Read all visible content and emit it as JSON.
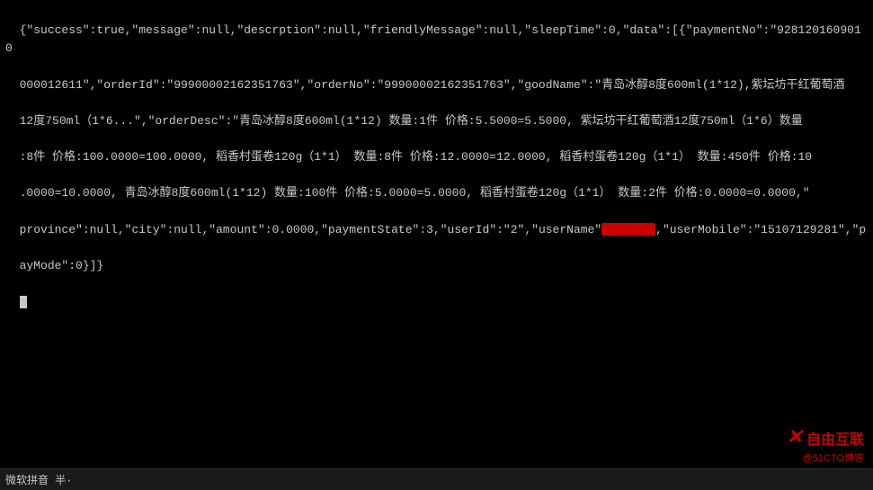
{
  "terminal": {
    "background": "#000000",
    "text_color": "#c8c8c8",
    "content_lines": [
      "{\"success\":true,\"message\":null,\"descrption\":null,\"friendlyMessage\":null,\"sleepTime\":0,\"data\":[{\"paymentNo\":\"9281201609010",
      "000012611\",\"orderId\":\"99900002162351763\",\"orderNo\":\"99900002162351763\",\"goodName\":\"青岛冰醇8度600ml(1*12),紫坛坊干红葡萄酒",
      "12度750ml（1*6...\"\"orderDesc\":\"青岛冰醇8度600ml(1*12) 数量:1件 价格:5.5000=5.5000, 紫坛坊干红葡萄酒12度750ml（1*6）数量",
      ":8件 价格:100.0000=100.0000, 稻香村蛋卷120g（1*1） 数量:8件 价格:12.0000=12.0000, 稻香村蛋卷120g（1*1） 数量:450件 价格:10",
      ".0000=10.0000, 青岛冰醇8度600ml(1*12) 数量:100件 价格:5.0000=5.0000, 稻香村蛋卷120g（1*1） 数量:2件 价格:0.0000=0.0000,\"",
      "province\":null,\"city\":null,\"amount\":0.0000,\"paymentState\":3,\"userId\":\"2\",\"userName\":[REDACTED],\"userMobile\":\"15107129281\",\"p",
      "ayMode\":0}]}"
    ],
    "highlighted_words": [
      "city",
      "amount"
    ],
    "cursor_line": ""
  },
  "watermark": {
    "logo_x": "✕",
    "brand": "自由互联",
    "sub_text": "@51CTO博客"
  },
  "status_bar": {
    "text": "微软拼音 半·"
  }
}
